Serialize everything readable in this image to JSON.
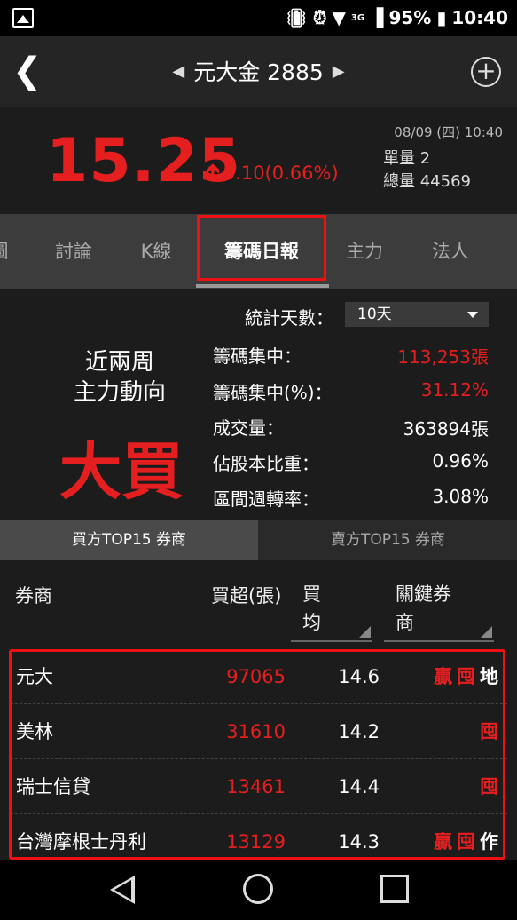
{
  "status_bar": {
    "battery": "95%",
    "time": "10:40",
    "network": "3G"
  },
  "header": {
    "title": "元大金 2885"
  },
  "quote": {
    "price": "15.25",
    "change": "0.10(0.66%)",
    "datetime": "08/09 (四) 10:40",
    "unit_volume_label": "單量",
    "unit_volume": "2",
    "total_volume_label": "總量",
    "total_volume": "44569"
  },
  "tabs": [
    "圖",
    "討論",
    "K線",
    "籌碼日報",
    "主力",
    "法人"
  ],
  "summary": {
    "days_label": "統計天數：",
    "days_value": "10天",
    "trend_line1": "近兩周",
    "trend_line2": "主力動向",
    "trend_value": "大買",
    "stats": [
      {
        "label": "籌碼集中：",
        "value": "113,253張",
        "color": "#e51f1f"
      },
      {
        "label": "籌碼集中(%)：",
        "value": "31.12%",
        "color": "#e51f1f"
      },
      {
        "label": "成交量：",
        "value": "363894張",
        "color": "#ffffff"
      },
      {
        "label": "佔股本比重：",
        "value": "0.96%",
        "color": "#ffffff"
      },
      {
        "label": "區間週轉率：",
        "value": "3.08%",
        "color": "#ffffff"
      }
    ]
  },
  "subtabs": {
    "buy": "買方TOP15 券商",
    "sell": "賣方TOP15 券商"
  },
  "table": {
    "col_broker": "券商",
    "col_net": "買超(張)",
    "col_avg_1": "買",
    "col_avg_2": "均",
    "col_key_1": "關鍵券",
    "col_key_2": "商",
    "rows": [
      {
        "broker": "元大",
        "net": "97065",
        "avg": "14.6",
        "tags": [
          "贏",
          "囤",
          "地"
        ]
      },
      {
        "broker": "美林",
        "net": "31610",
        "avg": "14.2",
        "tags": [
          "囤"
        ]
      },
      {
        "broker": "瑞士信貸",
        "net": "13461",
        "avg": "14.4",
        "tags": [
          "囤"
        ]
      },
      {
        "broker": "台灣摩根士丹利",
        "net": "13129",
        "avg": "14.3",
        "tags": [
          "贏",
          "囤",
          "作"
        ]
      }
    ]
  },
  "colors": {
    "up": "#e51f1f",
    "highlight": "#ee1111"
  }
}
